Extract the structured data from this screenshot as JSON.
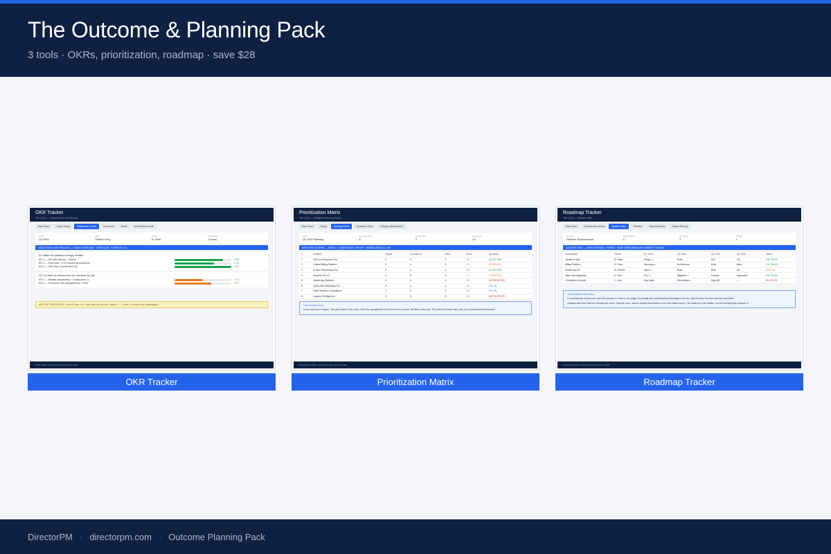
{
  "header": {
    "title": "The Outcome & Planning Pack",
    "subtitle": "3 tools · OKRs, prioritization, roadmap · save $28"
  },
  "footer": {
    "items": [
      "DirectorPM",
      "directorpm.com",
      "Outcome Planning Pack"
    ],
    "separator": "·"
  },
  "colors": {
    "navy": "#0f2142",
    "accent": "#2563eb",
    "green": "#16a34a",
    "orange": "#ea7a1b",
    "red": "#dc2626",
    "blue": "#2563eb"
  },
  "cards": [
    {
      "label": "OKR Tracker",
      "shot": {
        "title": "OKR Tracker",
        "subtitle": "Tab 3 of 6 — Objectives & Key Results",
        "tabs": [
          "Start Here",
          "Cycle Setup",
          "Objectives & KRs",
          "Check-ins",
          "Retro",
          "Anti-Pattern Audit"
        ],
        "active_tab": 2,
        "meta": [
          {
            "k": "Cycle",
            "v": "Q2 2026"
          },
          {
            "k": "Team",
            "v": "Platform Eng"
          },
          {
            "k": "Owner",
            "v": "R. Patel"
          },
          {
            "k": "Objectives",
            "v": "3 (max)"
          }
        ],
        "banner": "OBJECTIVES & KEY RESULTS — 3 OBJECTIVES MAX · 3 KRS EACH · SCORE 0.0–1.0",
        "objectives": [
          {
            "title": "O1  Make the platform boringly reliable",
            "krs": [
              {
                "text": "KR 1 — API p99 latency < 200ms",
                "score": "0.85",
                "value": 0.85,
                "color": "#16a34a"
              },
              {
                "text": "KR 2 — Error rate < 0.1% across all endpoints",
                "score": "0.70",
                "value": 0.7,
                "color": "#16a34a"
              },
              {
                "text": "KR 3 — Zero Sev-1 incidents in Q2",
                "score": "1.00",
                "value": 1.0,
                "color": "#16a34a"
              }
            ]
          },
          {
            "title": "O2  Cut time-to-onboard for new services by half",
            "krs": [
              {
                "text": "KR 1 — Median onboarding < 3 days (from 7)",
                "score": "0.50",
                "value": 0.5,
                "color": "#ea7a1b"
              },
              {
                "text": "KR 2 — Self-serve doc completeness > 90%",
                "score": "0.65",
                "value": 0.65,
                "color": "#ea7a1b"
              }
            ]
          }
        ],
        "warning": "ANTI-PATTERN CHECK: If all KRs are >0.9, they were set too low. Target 0.7 — score 1.0 means you sandbagged.",
        "footer": "OKR Tracker  |  directorpm.gumroad.com  |  $29"
      }
    },
    {
      "label": "Prioritization Matrix",
      "shot": {
        "title": "Prioritization Matrix",
        "subtitle": "Tab 3 of 6 — Weighted Scoring Sheet",
        "tabs": [
          "Start Here",
          "Setup",
          "Scoring Sheet",
          "Quadrant View",
          "Category Breakdown"
        ],
        "active_tab": 2,
        "meta": [
          {
            "k": "Cycle",
            "v": "Q2 2026 Planning"
          },
          {
            "k": "Items Scored",
            "v": "8"
          },
          {
            "k": "Quick Wins",
            "v": "2"
          },
          {
            "k": "Avg Score",
            "v": "3.6"
          }
        ],
        "banner": "WEIGHTED SCORING — IMPACT × CONFIDENCE / EFFORT · RANKED HIGH TO LOW",
        "columns": [
          "#",
          "Initiative",
          "Impact",
          "Confidence",
          "Effort",
          "Score",
          "Quadrant"
        ],
        "rows": [
          {
            "n": "1",
            "name": "SSO for Enterprise Tier",
            "impact": "5",
            "conf": "4",
            "effort": "2",
            "score": "4.9",
            "quad": "QUICK WIN",
            "color": "#16a34a"
          },
          {
            "n": "2",
            "name": "Unified Billing Platform",
            "impact": "5",
            "conf": "4",
            "effort": "5",
            "score": "4.3",
            "quad": "STRATEGIC",
            "color": "#ea7a1b"
          },
          {
            "n": "3",
            "name": "In-app Onboarding Tour",
            "impact": "4",
            "conf": "4",
            "effort": "2",
            "score": "3.8",
            "quad": "QUICK WIN",
            "color": "#16a34a"
          },
          {
            "n": "4",
            "name": "Reseller API v2",
            "impact": "4",
            "conf": "3",
            "effort": "5",
            "score": "3.7",
            "quad": "STRATEGIC",
            "color": "#ea7a1b"
          },
          {
            "n": "5",
            "name": "Mobile App Refresh",
            "impact": "3",
            "conf": "3",
            "effort": "4",
            "score": "3.3",
            "quad": "DEPRIORITIZE",
            "color": "#dc2626"
          },
          {
            "n": "6",
            "name": "Quick-Win Dashboard Fix",
            "impact": "3",
            "conf": "4",
            "effort": "2",
            "score": "3.1",
            "quad": "FILL-IN",
            "color": "#2563eb"
          },
          {
            "n": "7",
            "name": "Data Retention Compliance",
            "impact": "2",
            "conf": "5",
            "effort": "3",
            "score": "2.2",
            "quad": "FILL-IN",
            "color": "#2563eb"
          },
          {
            "n": "8",
            "name": "Legacy DB Migration",
            "impact": "3",
            "conf": "3",
            "effort": "5",
            "score": "2.2",
            "quad": "DEPRIORITIZE",
            "color": "#dc2626"
          }
        ],
        "note_title": "THE RANKING RULE",
        "note_body": "Force-rank top to bottom. Ties get broken in the room, not in the spreadsheet. If two items tie on score, the team picks one. The point is to leave with a list, not a bad tournament bracket.",
        "footer": "Prioritization Matrix  |  directorpm.gumroad.com  |  $29"
      }
    },
    {
      "label": "Roadmap Tracker",
      "shot": {
        "title": "Roadmap Tracker",
        "subtitle": "Tab 3 of 6 — Quarter View",
        "tabs": [
          "Start Here",
          "Workstream Setup",
          "Quarter View",
          "Timeline",
          "Dependencies",
          "Status Roll-Up"
        ],
        "active_tab": 2,
        "meta": [
          {
            "k": "Program",
            "v": "Platform Modernization"
          },
          {
            "k": "Workstreams",
            "v": "5"
          },
          {
            "k": "On Track",
            "v": "3"
          },
          {
            "k": "At Risk",
            "v": "1"
          }
        ],
        "banner": "QUARTER VIEW — WORKSTREAMS × PHASES · WHAT SHIPS WHEN AND WHERE IT STANDS",
        "columns": [
          "Workstream",
          "Owner",
          "Q1 2026",
          "Q2 2026",
          "Q3 2026",
          "Q4 2026",
          "Status"
        ],
        "rows": [
          {
            "ws": "Identity & Auth",
            "owner": "R. Patel",
            "q1": "Design ✓",
            "q2": "Build",
            "q3": "UAT",
            "q4": "GA",
            "status": "ON TRACK",
            "color": "#16a34a"
          },
          {
            "ws": "Billing Platform",
            "owner": "S. Chen",
            "q1": "Discovery ✓",
            "q2": "Architecture",
            "q3": "Build",
            "q4": "Beta",
            "status": "ON TRACK",
            "color": "#16a34a"
          },
          {
            "ws": "Mobile App v3",
            "owner": "M. Alvarez",
            "q1": "Specs ✓",
            "q2": "Build",
            "q3": "Beta",
            "q4": "GA",
            "status": "AT RISK",
            "color": "#ea7a1b"
          },
          {
            "ws": "Data Lake Migration",
            "owner": "K. Park",
            "q1": "POC ✓",
            "q2": "Migration ✓",
            "q3": "Cutover",
            "q4": "Hypercare",
            "status": "ON TRACK",
            "color": "#16a34a"
          },
          {
            "ws": "Compliance & Audit",
            "owner": "L. Ortiz",
            "q1": "Gap Audit",
            "q2": "Remediation",
            "q3": "Sign-Off",
            "q4": "—",
            "status": "BLOCKED",
            "color": "#dc2626"
          }
        ],
        "note_title": "THE QUARTER VIEW RULE",
        "note_body": "If a workstream needs more than four phases to read on one page, it's actually two workstreams pretending to be one. Split it before the next steering committee.",
        "note_body2": "Updates take less than five minutes per week. Cells flip color, owners explain themselves in the next status report. The roadmap is the artifact, not the meeting that produces it.",
        "footer": "Roadmap Tracker  |  directorpm.gumroad.com  |  $29"
      }
    }
  ]
}
